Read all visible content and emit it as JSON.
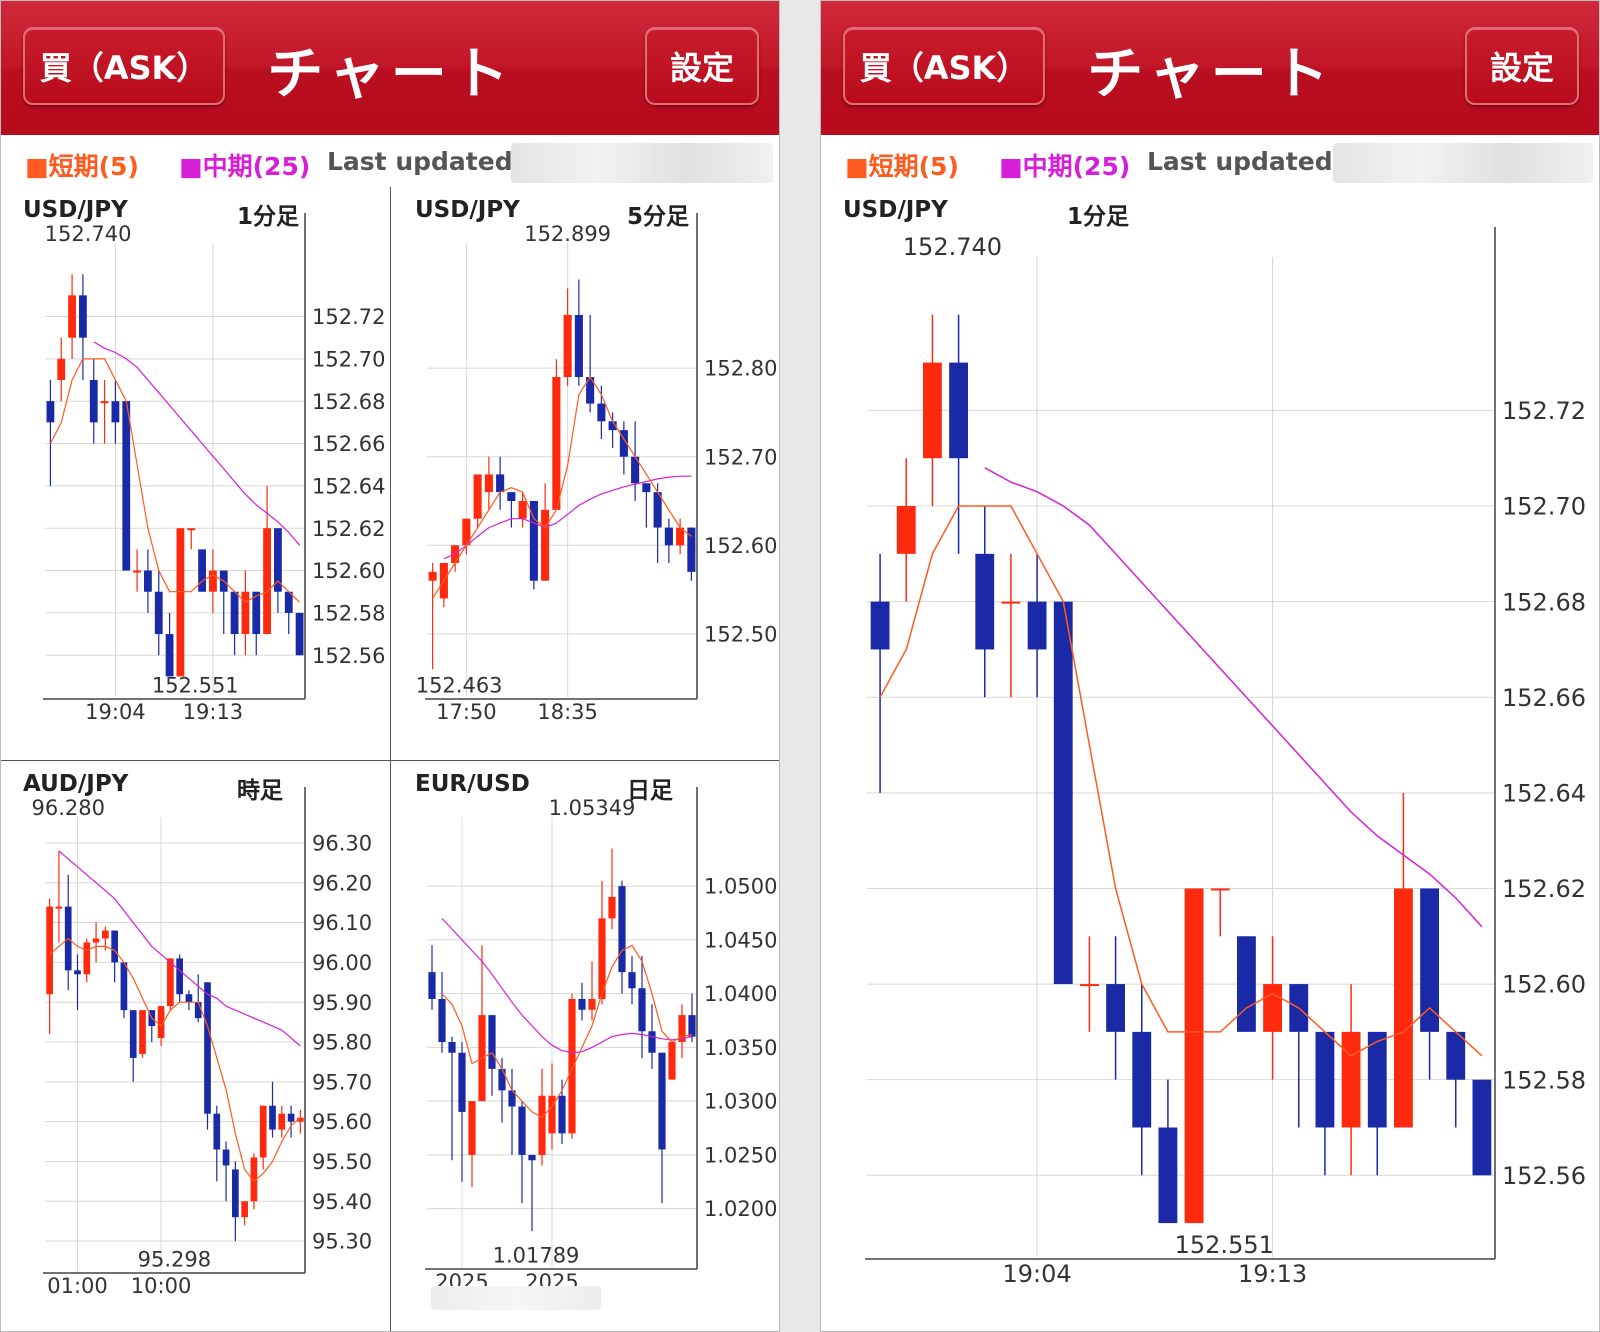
{
  "header": {
    "buy_button": "買（ASK）",
    "title": "チャート",
    "settings_button": "設定"
  },
  "legend": {
    "short": "■短期(5)",
    "mid": "■中期(25)",
    "last_updated": "Last updated :"
  },
  "colors": {
    "up": "#ff2a0d",
    "down": "#1a2aa6",
    "short_ma": "#ff5a1f",
    "mid_ma": "#d61fd6",
    "header": "#c11627"
  },
  "chart_data": [
    {
      "id": "usdjpy_1m",
      "type": "candlestick",
      "pair": "USD/JPY",
      "timeframe": "1分足",
      "ylim": [
        152.545,
        152.75
      ],
      "yticks": [
        152.56,
        152.58,
        152.6,
        152.62,
        152.64,
        152.66,
        152.68,
        152.7,
        152.72
      ],
      "ytick_labels": [
        "152.56",
        "152.58",
        "152.60",
        "152.62",
        "152.64",
        "152.66",
        "152.68",
        "152.70",
        "152.72"
      ],
      "x_labels": [
        {
          "i": 6,
          "label": "19:04"
        },
        {
          "i": 15,
          "label": "19:13"
        }
      ],
      "high_label": {
        "i": 2,
        "value": "152.740"
      },
      "low_label": {
        "i": 13,
        "value": "152.551"
      },
      "candles": [
        [
          152.68,
          152.69,
          152.65,
          152.67,
          152.64
        ],
        [
          152.69,
          152.71,
          152.7,
          152.7,
          152.68
        ],
        [
          152.71,
          152.74,
          152.71,
          152.73,
          152.7
        ],
        [
          152.73,
          152.74,
          152.69,
          152.71,
          152.69
        ],
        [
          152.69,
          152.7,
          152.67,
          152.67,
          152.66
        ],
        [
          152.68,
          152.69,
          152.68,
          152.68,
          152.66
        ],
        [
          152.68,
          152.69,
          152.67,
          152.67,
          152.66
        ],
        [
          152.68,
          152.68,
          152.6,
          152.6,
          152.6
        ],
        [
          152.6,
          152.61,
          152.6,
          152.6,
          152.59
        ],
        [
          152.6,
          152.61,
          152.59,
          152.59,
          152.58
        ],
        [
          152.59,
          152.6,
          152.56,
          152.57,
          152.56
        ],
        [
          152.57,
          152.58,
          152.55,
          152.55,
          152.55
        ],
        [
          152.55,
          152.62,
          152.55,
          152.62,
          152.55
        ],
        [
          152.62,
          152.62,
          152.61,
          152.62,
          152.61
        ],
        [
          152.61,
          152.61,
          152.59,
          152.59,
          152.59
        ],
        [
          152.59,
          152.61,
          152.59,
          152.6,
          152.58
        ],
        [
          152.6,
          152.6,
          152.59,
          152.59,
          152.57
        ],
        [
          152.59,
          152.59,
          152.57,
          152.57,
          152.56
        ],
        [
          152.57,
          152.6,
          152.57,
          152.59,
          152.56
        ],
        [
          152.59,
          152.59,
          152.57,
          152.57,
          152.56
        ],
        [
          152.57,
          152.64,
          152.57,
          152.62,
          152.57
        ],
        [
          152.62,
          152.62,
          152.59,
          152.59,
          152.58
        ],
        [
          152.59,
          152.59,
          152.58,
          152.58,
          152.57
        ],
        [
          152.58,
          152.58,
          152.56,
          152.56,
          152.56
        ]
      ],
      "sma5": [
        152.66,
        152.67,
        152.69,
        152.7,
        152.7,
        152.7,
        152.69,
        152.68,
        152.65,
        152.62,
        152.6,
        152.59,
        152.59,
        152.59,
        152.595,
        152.598,
        152.595,
        152.59,
        152.585,
        152.588,
        152.59,
        152.595,
        152.59,
        152.585
      ],
      "sma25": [
        null,
        null,
        null,
        null,
        152.708,
        152.705,
        152.703,
        152.7,
        152.696,
        152.69,
        152.684,
        152.678,
        152.672,
        152.666,
        152.66,
        152.654,
        152.648,
        152.642,
        152.636,
        152.631,
        152.627,
        152.623,
        152.618,
        152.612
      ]
    },
    {
      "id": "usdjpy_5m",
      "type": "candlestick",
      "pair": "USD/JPY",
      "timeframe": "5分足",
      "ylim": [
        152.44,
        152.93
      ],
      "yticks": [
        152.5,
        152.6,
        152.7,
        152.8
      ],
      "ytick_labels": [
        "152.50",
        "152.60",
        "152.70",
        "152.80"
      ],
      "x_labels": [
        {
          "i": 3,
          "label": "17:50"
        },
        {
          "i": 12,
          "label": "18:35"
        }
      ],
      "high_label": {
        "i": 12,
        "value": "152.899"
      },
      "low_label": {
        "i": 2,
        "value": "152.463"
      },
      "candles": [
        [
          152.56,
          152.58,
          152.48,
          152.57,
          152.46
        ],
        [
          152.54,
          152.58,
          152.54,
          152.58,
          152.53
        ],
        [
          152.58,
          152.6,
          152.58,
          152.6,
          152.57
        ],
        [
          152.6,
          152.63,
          152.6,
          152.63,
          152.59
        ],
        [
          152.63,
          152.68,
          152.63,
          152.68,
          152.62
        ],
        [
          152.66,
          152.7,
          152.66,
          152.68,
          152.64
        ],
        [
          152.68,
          152.7,
          152.66,
          152.66,
          152.64
        ],
        [
          152.66,
          152.66,
          152.65,
          152.65,
          152.62
        ],
        [
          152.63,
          152.66,
          152.63,
          152.65,
          152.62
        ],
        [
          152.65,
          152.65,
          152.56,
          152.56,
          152.55
        ],
        [
          152.56,
          152.67,
          152.56,
          152.64,
          152.56
        ],
        [
          152.64,
          152.81,
          152.64,
          152.79,
          152.64
        ],
        [
          152.79,
          152.89,
          152.79,
          152.86,
          152.78
        ],
        [
          152.86,
          152.9,
          152.79,
          152.79,
          152.78
        ],
        [
          152.79,
          152.86,
          152.79,
          152.76,
          152.75
        ],
        [
          152.76,
          152.78,
          152.73,
          152.74,
          152.72
        ],
        [
          152.74,
          152.75,
          152.72,
          152.73,
          152.71
        ],
        [
          152.73,
          152.74,
          152.69,
          152.7,
          152.68
        ],
        [
          152.7,
          152.74,
          152.65,
          152.67,
          152.65
        ],
        [
          152.67,
          152.67,
          152.63,
          152.66,
          152.62
        ],
        [
          152.66,
          152.67,
          152.61,
          152.62,
          152.58
        ],
        [
          152.62,
          152.63,
          152.6,
          152.6,
          152.58
        ],
        [
          152.6,
          152.63,
          152.6,
          152.62,
          152.59
        ],
        [
          152.62,
          152.62,
          152.56,
          152.57,
          152.56
        ]
      ],
      "sma5": [
        152.54,
        152.56,
        152.58,
        152.6,
        152.62,
        152.64,
        152.66,
        152.665,
        152.66,
        152.63,
        152.62,
        152.64,
        152.69,
        152.77,
        152.79,
        152.77,
        152.74,
        152.72,
        152.7,
        152.68,
        152.66,
        152.64,
        152.62,
        152.61
      ],
      "sma25": [
        null,
        152.585,
        152.59,
        152.6,
        152.61,
        152.62,
        152.625,
        152.63,
        152.63,
        152.625,
        152.62,
        152.625,
        152.635,
        152.645,
        152.652,
        152.658,
        152.662,
        152.666,
        152.669,
        152.672,
        152.675,
        152.677,
        152.678,
        152.678
      ]
    },
    {
      "id": "audjpy_1h",
      "type": "candlestick",
      "pair": "AUD/JPY",
      "timeframe": "時足",
      "ylim": [
        95.25,
        96.34
      ],
      "yticks": [
        95.3,
        95.4,
        95.5,
        95.6,
        95.7,
        95.8,
        95.9,
        96.0,
        96.1,
        96.2,
        96.3
      ],
      "ytick_labels": [
        "95.30",
        "95.40",
        "95.50",
        "95.60",
        "95.70",
        "95.80",
        "95.90",
        "96.00",
        "96.10",
        "96.20",
        "96.30"
      ],
      "x_labels": [
        {
          "i": 3,
          "label": "01:00"
        },
        {
          "i": 12,
          "label": "10:00"
        }
      ],
      "high_label": {
        "i": 2,
        "value": "96.280"
      },
      "low_label": {
        "i": 13,
        "value": "95.298"
      },
      "candles": [
        [
          95.92,
          96.16,
          95.82,
          96.14,
          95.82
        ],
        [
          96.14,
          96.28,
          96.14,
          96.14,
          96.05
        ],
        [
          96.14,
          96.22,
          96.0,
          95.98,
          95.93
        ],
        [
          95.98,
          96.02,
          95.98,
          95.97,
          95.88
        ],
        [
          95.97,
          96.06,
          95.97,
          96.05,
          95.95
        ],
        [
          96.05,
          96.1,
          96.04,
          96.06,
          96.0
        ],
        [
          96.06,
          96.09,
          96.06,
          96.08,
          96.03
        ],
        [
          96.08,
          96.08,
          96.0,
          96.0,
          95.95
        ],
        [
          96.0,
          96.0,
          95.88,
          95.88,
          95.86
        ],
        [
          95.88,
          95.88,
          95.76,
          95.76,
          95.7
        ],
        [
          95.77,
          95.88,
          95.77,
          95.88,
          95.76
        ],
        [
          95.88,
          95.88,
          95.84,
          95.84,
          95.8
        ],
        [
          95.81,
          95.89,
          95.81,
          95.89,
          95.79
        ],
        [
          95.89,
          96.01,
          95.89,
          96.01,
          95.88
        ],
        [
          96.01,
          96.02,
          95.92,
          95.92,
          95.9
        ],
        [
          95.92,
          95.93,
          95.9,
          95.9,
          95.88
        ],
        [
          95.9,
          95.97,
          95.86,
          95.86,
          95.85
        ],
        [
          95.95,
          95.95,
          95.62,
          95.62,
          95.58
        ],
        [
          95.62,
          95.64,
          95.53,
          95.53,
          95.45
        ],
        [
          95.53,
          95.55,
          95.49,
          95.49,
          95.4
        ],
        [
          95.48,
          95.5,
          95.35,
          95.36,
          95.3
        ],
        [
          95.36,
          95.4,
          95.36,
          95.4,
          95.34
        ],
        [
          95.4,
          95.52,
          95.4,
          95.51,
          95.38
        ],
        [
          95.51,
          95.64,
          95.51,
          95.64,
          95.48
        ],
        [
          95.64,
          95.7,
          95.58,
          95.58,
          95.56
        ],
        [
          95.58,
          95.64,
          95.58,
          95.62,
          95.56
        ],
        [
          95.62,
          95.64,
          95.58,
          95.6,
          95.56
        ],
        [
          95.6,
          95.63,
          95.6,
          95.61,
          95.57
        ]
      ],
      "sma5": [
        96.02,
        96.04,
        96.06,
        96.04,
        96.03,
        96.04,
        96.04,
        96.03,
        96.0,
        95.96,
        95.91,
        95.86,
        95.84,
        95.88,
        95.9,
        95.9,
        95.9,
        95.84,
        95.76,
        95.68,
        95.57,
        95.48,
        95.45,
        95.47,
        95.5,
        95.55,
        95.59,
        95.61
      ],
      "sma25": [
        null,
        96.28,
        96.26,
        96.24,
        96.22,
        96.2,
        96.18,
        96.16,
        96.13,
        96.1,
        96.07,
        96.04,
        96.02,
        96.0,
        95.98,
        95.96,
        95.94,
        95.92,
        95.91,
        95.89,
        95.88,
        95.87,
        95.86,
        95.85,
        95.84,
        95.83,
        95.81,
        95.79
      ]
    },
    {
      "id": "eurusd_1d",
      "type": "candlestick",
      "pair": "EUR/USD",
      "timeframe": "日足",
      "ylim": [
        1.0155,
        1.0555
      ],
      "yticks": [
        1.02,
        1.025,
        1.03,
        1.035,
        1.04,
        1.045,
        1.05
      ],
      "ytick_labels": [
        "1.0200",
        "1.0250",
        "1.0300",
        "1.0350",
        "1.0400",
        "1.0450",
        "1.0500"
      ],
      "x_labels": [
        {
          "i": 3,
          "label": "2025"
        },
        {
          "i": 12,
          "label": "2025"
        }
      ],
      "high_label": {
        "i": 16,
        "value": "1.05349"
      },
      "low_label": {
        "i": 10,
        "value": "1.01789"
      },
      "candles": [
        [
          1.042,
          1.0445,
          1.0415,
          1.0395,
          1.0385
        ],
        [
          1.0395,
          1.042,
          1.036,
          1.0355,
          1.0345
        ],
        [
          1.0355,
          1.036,
          1.034,
          1.0345,
          1.0245
        ],
        [
          1.0345,
          1.0355,
          1.0285,
          1.029,
          1.0225
        ],
        [
          1.025,
          1.03,
          1.025,
          1.03,
          1.022
        ],
        [
          1.03,
          1.0445,
          1.03,
          1.038,
          1.03
        ],
        [
          1.038,
          1.038,
          1.033,
          1.033,
          1.0305
        ],
        [
          1.033,
          1.034,
          1.0315,
          1.031,
          1.028
        ],
        [
          1.031,
          1.033,
          1.0295,
          1.0295,
          1.025
        ],
        [
          1.0295,
          1.03,
          1.025,
          1.025,
          1.0205
        ],
        [
          1.025,
          1.025,
          1.0245,
          1.0245,
          1.0179
        ],
        [
          1.025,
          1.033,
          1.025,
          1.0305,
          1.024
        ],
        [
          1.027,
          1.0335,
          1.027,
          1.0305,
          1.0255
        ],
        [
          1.0305,
          1.032,
          1.026,
          1.027,
          1.026
        ],
        [
          1.027,
          1.04,
          1.027,
          1.0395,
          1.0265
        ],
        [
          1.0395,
          1.041,
          1.039,
          1.0385,
          1.0375
        ],
        [
          1.0385,
          1.043,
          1.0385,
          1.0395,
          1.0375
        ],
        [
          1.0395,
          1.0505,
          1.0395,
          1.047,
          1.039
        ],
        [
          1.047,
          1.0535,
          1.047,
          1.049,
          1.046
        ],
        [
          1.05,
          1.0505,
          1.042,
          1.042,
          1.04
        ],
        [
          1.042,
          1.0435,
          1.0405,
          1.0405,
          1.039
        ],
        [
          1.0405,
          1.0435,
          1.036,
          1.0365,
          1.034
        ],
        [
          1.0365,
          1.039,
          1.034,
          1.0345,
          1.033
        ],
        [
          1.0345,
          1.0345,
          1.025,
          1.0255,
          1.0205
        ],
        [
          1.032,
          1.0355,
          1.032,
          1.0355,
          1.032
        ],
        [
          1.0355,
          1.039,
          1.0345,
          1.038,
          1.034
        ],
        [
          1.038,
          1.04,
          1.036,
          1.036,
          1.0355
        ]
      ],
      "sma5": [
        null,
        1.04,
        1.039,
        1.037,
        1.0335,
        1.034,
        1.0345,
        1.033,
        1.031,
        1.03,
        1.029,
        1.0285,
        1.0295,
        1.031,
        1.033,
        1.035,
        1.037,
        1.04,
        1.0425,
        1.044,
        1.0445,
        1.043,
        1.04,
        1.0365,
        1.0355,
        1.036,
        1.0362
      ],
      "sma25": [
        null,
        1.047,
        1.046,
        1.045,
        1.044,
        1.043,
        1.0418,
        1.0405,
        1.0392,
        1.038,
        1.037,
        1.036,
        1.0352,
        1.0347,
        1.0345,
        1.0346,
        1.035,
        1.0355,
        1.036,
        1.0362,
        1.0363,
        1.0362,
        1.036,
        1.0358,
        1.0357,
        1.0358,
        1.036
      ]
    }
  ]
}
